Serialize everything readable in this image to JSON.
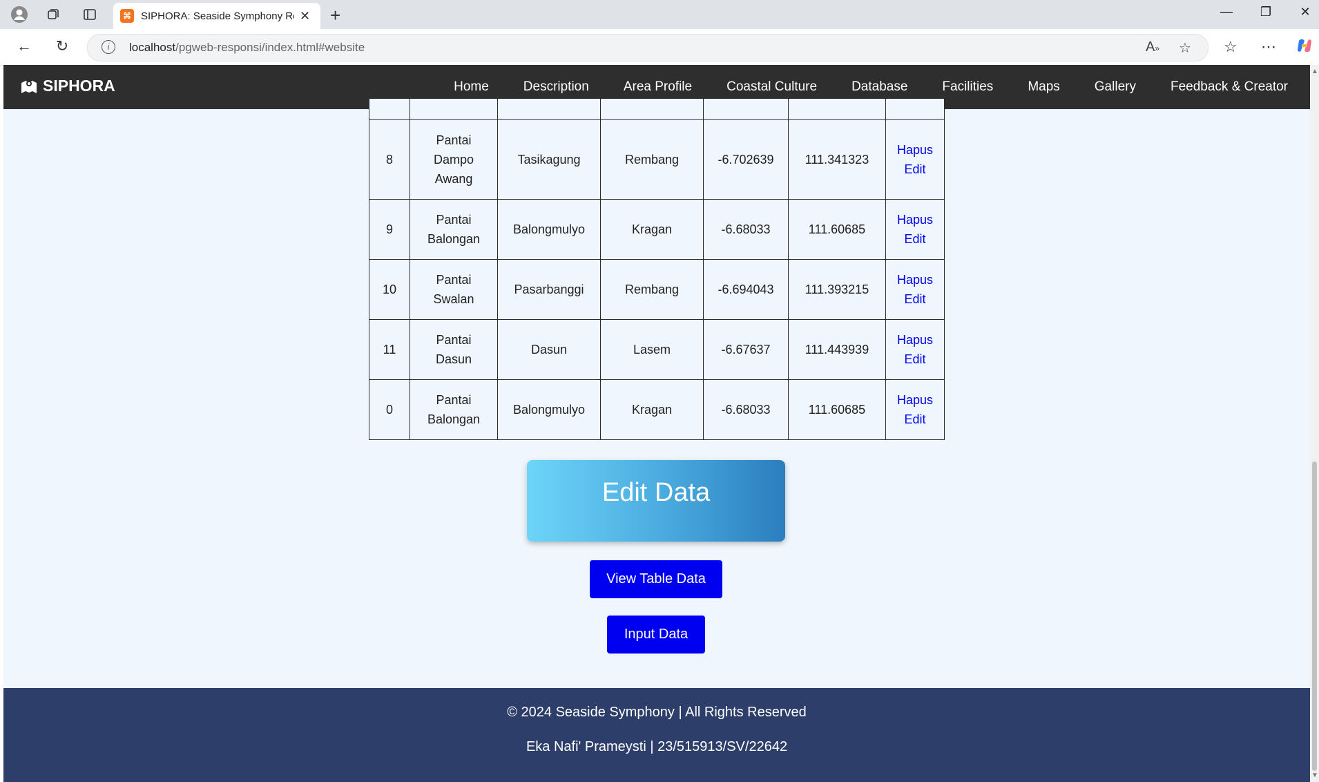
{
  "browser": {
    "tab_title": "SIPHORA: Seaside Symphony Ren",
    "url_host": "localhost",
    "url_path": "/pgweb-responsi/index.html#website"
  },
  "navbar": {
    "brand": "SIPHORA",
    "menu": [
      "Home",
      "Description",
      "Area Profile",
      "Coastal Culture",
      "Database",
      "Facilities",
      "Maps",
      "Gallery",
      "Feedback & Creator"
    ]
  },
  "table": {
    "rows": [
      {
        "no": "8",
        "nama": [
          "Pantai",
          "Dampo",
          "Awang"
        ],
        "desa": "Tasikagung",
        "kecamatan": "Rembang",
        "lat": "-6.702639",
        "lon": "111.341323"
      },
      {
        "no": "9",
        "nama": [
          "Pantai",
          "Balongan"
        ],
        "desa": "Balongmulyo",
        "kecamatan": "Kragan",
        "lat": "-6.68033",
        "lon": "111.60685"
      },
      {
        "no": "10",
        "nama": [
          "Pantai",
          "Swalan"
        ],
        "desa": "Pasarbanggi",
        "kecamatan": "Rembang",
        "lat": "-6.694043",
        "lon": "111.393215"
      },
      {
        "no": "11",
        "nama": [
          "Pantai",
          "Dasun"
        ],
        "desa": "Dasun",
        "kecamatan": "Lasem",
        "lat": "-6.67637",
        "lon": "111.443939"
      },
      {
        "no": "0",
        "nama": [
          "Pantai",
          "Balongan"
        ],
        "desa": "Balongmulyo",
        "kecamatan": "Kragan",
        "lat": "-6.68033",
        "lon": "111.60685"
      }
    ],
    "action_delete": "Hapus",
    "action_edit": "Edit"
  },
  "edit_banner": "Edit Data",
  "buttons": {
    "view_table": "View Table Data",
    "input_data": "Input Data"
  },
  "footer": {
    "copyright": "© 2024 Seaside Symphony | All Rights Reserved",
    "author": "Eka Nafi' Prameysti | 23/515913/SV/22642"
  }
}
